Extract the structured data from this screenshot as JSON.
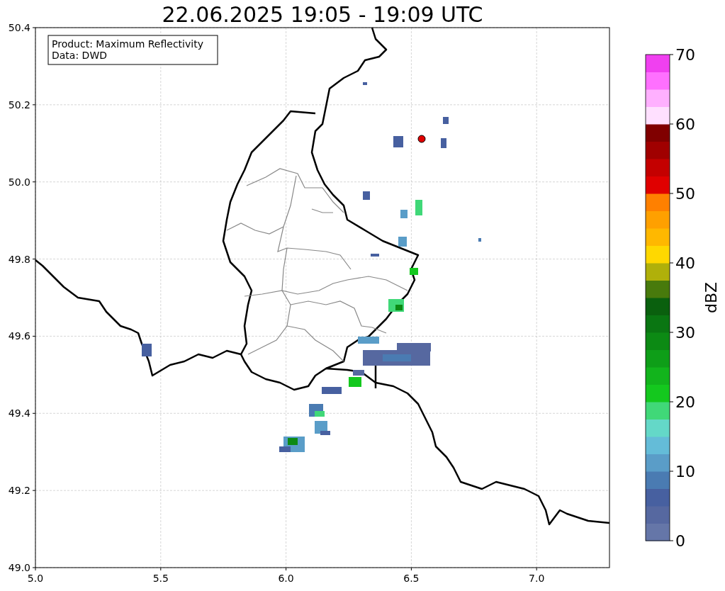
{
  "title": "22.06.2025 19:05 - 19:09 UTC",
  "map": {
    "xticks": [
      "5.0",
      "5.5",
      "6.0",
      "6.5",
      "7.0"
    ],
    "yticks": [
      "50.4",
      "50.2",
      "50.0",
      "49.8",
      "49.6",
      "49.4",
      "49.2",
      "49.0"
    ],
    "info_box": [
      "Product: Maximum Reflectivity",
      "Data: DWD"
    ]
  },
  "colorbar": {
    "ticks": [
      "70",
      "60",
      "50",
      "40",
      "30",
      "20",
      "10",
      "0"
    ],
    "label": "dBZ"
  }
}
